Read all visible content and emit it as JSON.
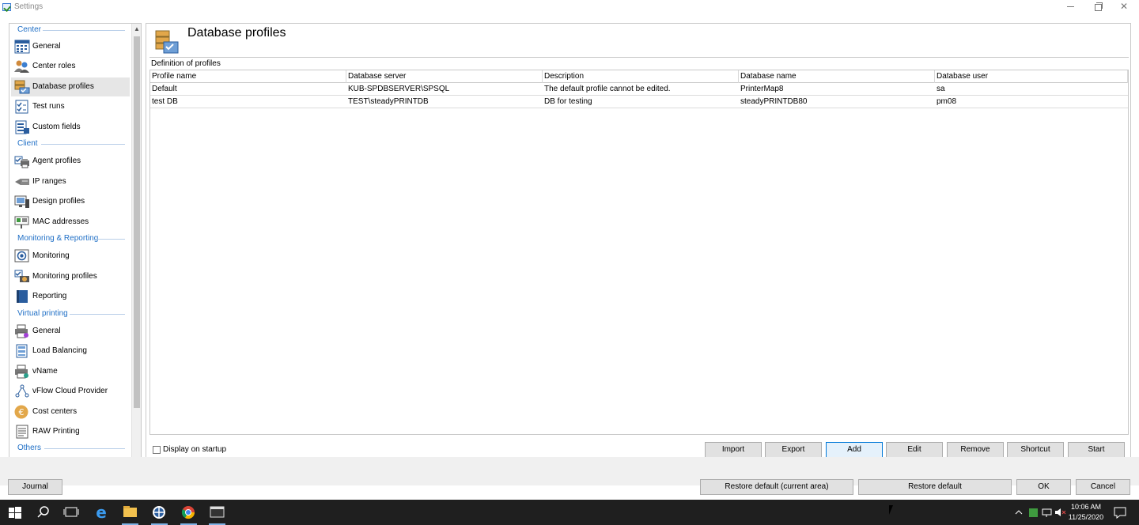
{
  "window": {
    "title": "Settings",
    "minimize_label": "—",
    "maximize_label": "",
    "close_label": "✕"
  },
  "sidebar": {
    "sections": [
      {
        "title": "Center",
        "items": [
          {
            "label": "General",
            "icon": "grid-icon"
          },
          {
            "label": "Center roles",
            "icon": "users-icon"
          },
          {
            "label": "Database profiles",
            "icon": "database-icon",
            "active": true
          },
          {
            "label": "Test runs",
            "icon": "checklist-icon"
          },
          {
            "label": "Custom fields",
            "icon": "form-icon"
          }
        ]
      },
      {
        "title": "Client",
        "items": [
          {
            "label": "Agent profiles",
            "icon": "agent-icon"
          },
          {
            "label": "IP ranges",
            "icon": "network-plug-icon"
          },
          {
            "label": "Design profiles",
            "icon": "monitor-design-icon"
          },
          {
            "label": "MAC addresses",
            "icon": "network-card-icon"
          }
        ]
      },
      {
        "title": "Monitoring & Reporting",
        "items": [
          {
            "label": "Monitoring",
            "icon": "monitoring-icon"
          },
          {
            "label": "Monitoring profiles",
            "icon": "monitoring-profile-icon"
          },
          {
            "label": "Reporting",
            "icon": "book-icon"
          }
        ]
      },
      {
        "title": "Virtual printing",
        "items": [
          {
            "label": "General",
            "icon": "printer-icon"
          },
          {
            "label": "Load Balancing",
            "icon": "load-balancing-icon"
          },
          {
            "label": "vName",
            "icon": "printer-name-icon"
          },
          {
            "label": "vFlow Cloud Provider",
            "icon": "cloud-flow-icon"
          },
          {
            "label": "Cost centers",
            "icon": "euro-icon"
          },
          {
            "label": "RAW Printing",
            "icon": "document-icon"
          }
        ]
      },
      {
        "title": "Others",
        "items": []
      }
    ],
    "scroll_up": "▲",
    "scroll_down": "▼"
  },
  "page": {
    "title": "Database profiles",
    "group_title": "Definition of profiles",
    "columns": [
      "Profile name",
      "Database server",
      "Description",
      "Database name",
      "Database user"
    ],
    "rows": [
      [
        "Default",
        "KUB-SPDBSERVER\\SPSQL",
        "The default profile cannot be edited.",
        "PrinterMap8",
        "sa"
      ],
      [
        "test DB",
        "TEST\\steadyPRINTDB",
        "DB for testing",
        "steadyPRINTDB80",
        "pm08"
      ]
    ],
    "display_on_startup": "Display on startup",
    "buttons": {
      "import": "Import",
      "export": "Export",
      "add": "Add",
      "edit": "Edit",
      "remove": "Remove",
      "shortcut": "Shortcut",
      "start": "Start"
    }
  },
  "footer": {
    "journal": "Journal",
    "restore_area": "Restore default (current area)",
    "restore_default": "Restore default",
    "ok": "OK",
    "cancel": "Cancel"
  },
  "taskbar": {
    "time": "10:06 AM",
    "date": "11/25/2020"
  },
  "colors": {
    "accent": "#1f6fc6",
    "selected_row": "#e6e6e6",
    "primary_button_border": "#0078d7"
  }
}
